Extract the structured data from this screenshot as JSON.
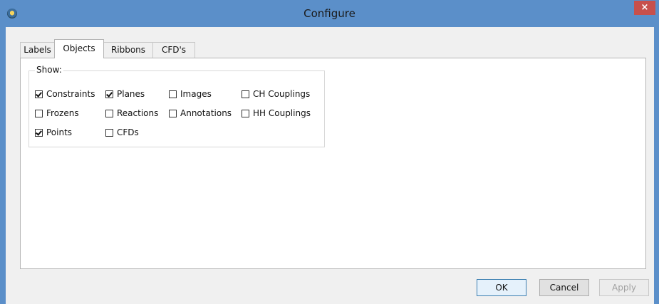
{
  "window": {
    "title": "Configure",
    "close_symbol": "×"
  },
  "tabs": [
    {
      "label": "Labels",
      "active": false
    },
    {
      "label": "Objects",
      "active": true
    },
    {
      "label": "Ribbons",
      "active": false
    },
    {
      "label": "CFD's",
      "active": false
    }
  ],
  "show_group": {
    "legend": "Show:",
    "options": [
      {
        "label": "Constraints",
        "checked": true
      },
      {
        "label": "Planes",
        "checked": true
      },
      {
        "label": "Images",
        "checked": false
      },
      {
        "label": "CH Couplings",
        "checked": false
      },
      {
        "label": "Frozens",
        "checked": false
      },
      {
        "label": "Reactions",
        "checked": false
      },
      {
        "label": "Annotations",
        "checked": false
      },
      {
        "label": "HH Couplings",
        "checked": false
      },
      {
        "label": "Points",
        "checked": true
      },
      {
        "label": "CFDs",
        "checked": false
      }
    ]
  },
  "buttons": {
    "ok": "OK",
    "cancel": "Cancel",
    "apply": "Apply"
  },
  "colors": {
    "titlebar": "#5b8fc9",
    "close": "#c7504c",
    "dialog_bg": "#f0f0f0"
  }
}
